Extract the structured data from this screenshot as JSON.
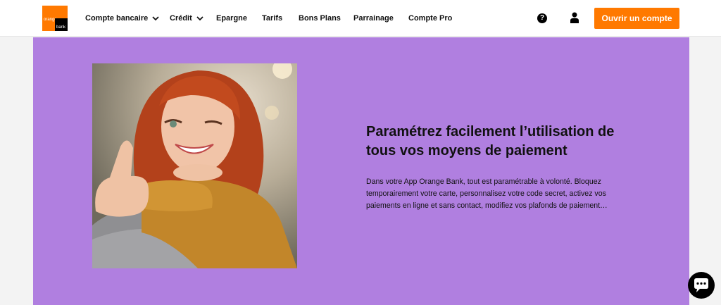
{
  "brand": {
    "logo_line1": "orange",
    "logo_line2": "bank"
  },
  "nav": {
    "items": [
      {
        "label": "Compte bancaire",
        "dropdown": true
      },
      {
        "label": "Crédit",
        "dropdown": true
      },
      {
        "label": "Epargne",
        "dropdown": false
      },
      {
        "label": "Tarifs",
        "dropdown": false
      },
      {
        "label": "Bons Plans",
        "dropdown": false
      },
      {
        "label": "Parrainage",
        "dropdown": false
      },
      {
        "label": "Compte Pro",
        "dropdown": false
      }
    ],
    "help_icon": "question-circle-icon",
    "user_icon": "user-icon",
    "cta_label": "Ouvrir un compte"
  },
  "hero": {
    "title": "Paramétrez facilement l’utilisation de tous vos moyens de paiement",
    "body": "Dans votre App Orange Bank, tout est paramétrable à volonté. Bloquez temporairement votre carte, personnalisez votre code secret, activez vos paiements en ligne et sans contact, modifiez vos plafonds de paiement…",
    "image_alt": "smiling woman giving thumbs up"
  },
  "chat": {
    "icon": "chat-bubble-icon"
  },
  "colors": {
    "brand": "#ff7900",
    "hero_bg": "#b07fe0",
    "text": "#111111"
  }
}
